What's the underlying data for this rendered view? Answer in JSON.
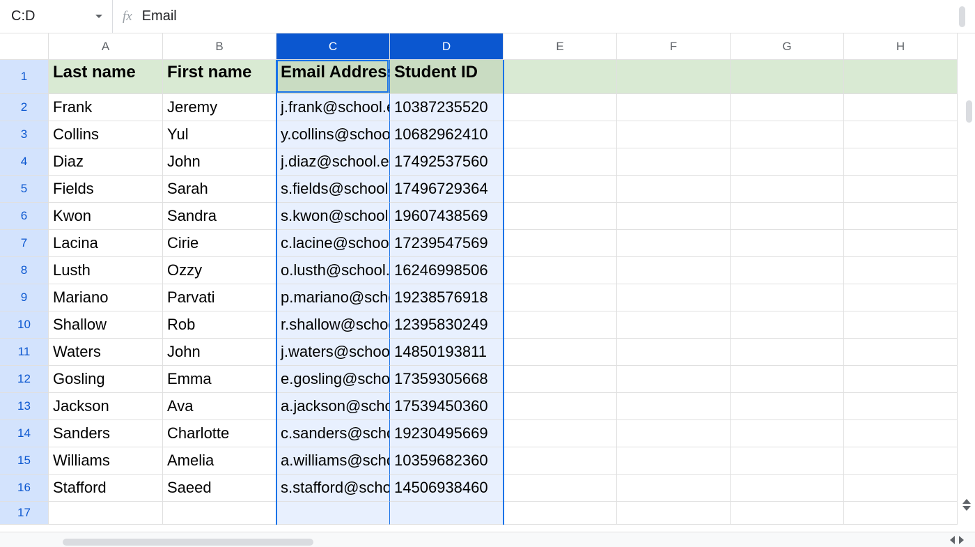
{
  "namebox": "C:D",
  "formula": "Email",
  "fx_label": "fx",
  "columns": [
    {
      "label": "A",
      "width": 164,
      "selected": false
    },
    {
      "label": "B",
      "width": 163,
      "selected": false
    },
    {
      "label": "C",
      "width": 163,
      "selected": true
    },
    {
      "label": "D",
      "width": 163,
      "selected": true
    },
    {
      "label": "E",
      "width": 163,
      "selected": false
    },
    {
      "label": "F",
      "width": 163,
      "selected": false
    },
    {
      "label": "G",
      "width": 163,
      "selected": false
    },
    {
      "label": "H",
      "width": 163,
      "selected": false
    }
  ],
  "header_row_height": 49,
  "data_row_height": 39,
  "empty_row_height": 33,
  "row_numbers": [
    1,
    2,
    3,
    4,
    5,
    6,
    7,
    8,
    9,
    10,
    11,
    12,
    13,
    14,
    15,
    16,
    17
  ],
  "headers": [
    "Last name",
    "First name",
    "Email Address",
    "Student ID"
  ],
  "rows": [
    [
      "Frank",
      "Jeremy",
      "j.frank@school.edu",
      "10387235520"
    ],
    [
      "Collins",
      "Yul",
      "y.collins@school.edu",
      "10682962410"
    ],
    [
      "Diaz",
      "John",
      "j.diaz@school.edu",
      "17492537560"
    ],
    [
      "Fields",
      "Sarah",
      "s.fields@school.edu",
      "17496729364"
    ],
    [
      "Kwon",
      "Sandra",
      "s.kwon@school.edu",
      "19607438569"
    ],
    [
      "Lacina",
      "Cirie",
      "c.lacine@school.edu",
      "17239547569"
    ],
    [
      "Lusth",
      "Ozzy",
      "o.lusth@school.edu",
      "16246998506"
    ],
    [
      "Mariano",
      "Parvati",
      "p.mariano@school.edu",
      "19238576918"
    ],
    [
      "Shallow",
      "Rob",
      "r.shallow@school.edu",
      "12395830249"
    ],
    [
      "Waters",
      "John",
      "j.waters@school.edu",
      "14850193811"
    ],
    [
      "Gosling",
      "Emma",
      "e.gosling@school.edu",
      "17359305668"
    ],
    [
      "Jackson",
      "Ava",
      "a.jackson@school.edu",
      "17539450360"
    ],
    [
      "Sanders",
      "Charlotte",
      "c.sanders@school.edu",
      "19230495669"
    ],
    [
      "Williams",
      "Amelia",
      "a.williams@school.edu",
      "10359682360"
    ],
    [
      "Stafford",
      "Saeed",
      "s.stafford@school.edu",
      "14506938460"
    ]
  ],
  "email_truncated": [
    "j.frank@schoo",
    "y.collins@sch",
    "j.diaz@schoo",
    "s.fields@scho",
    "s.kwon@scho",
    "c.lacine@sch",
    "o.lusth@scho",
    "p.mariano@s",
    "r.shallow@scl",
    "j.waters@sch",
    "e.gosling@sc",
    "a.jackson@sc",
    "c.sanders@s",
    "a.williams@sc",
    "s.stafford@sc"
  ]
}
